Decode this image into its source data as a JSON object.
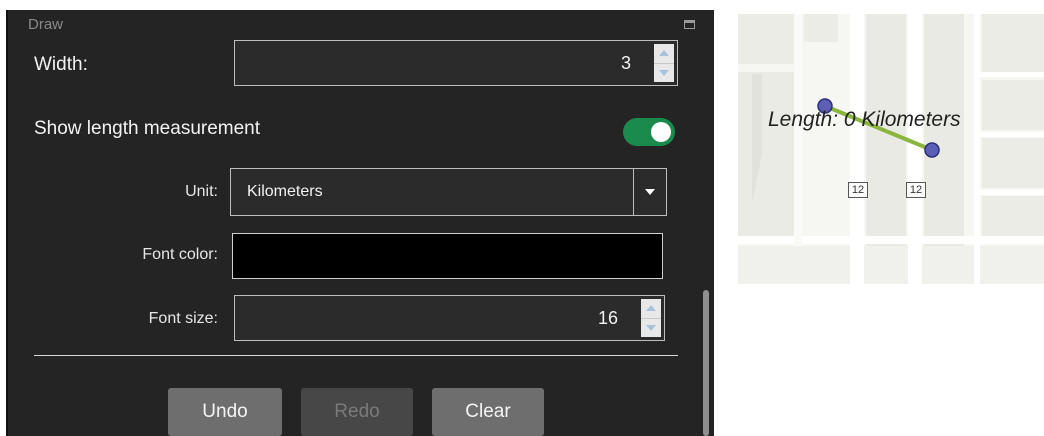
{
  "panel": {
    "title": "Draw",
    "width_label": "Width:",
    "width_value": "3",
    "show_length_label": "Show length measurement",
    "show_length_enabled": true,
    "unit_label": "Unit:",
    "unit_value": "Kilometers",
    "font_color_label": "Font color:",
    "font_color_value": "#000000",
    "font_size_label": "Font size:",
    "font_size_value": "16",
    "buttons": {
      "undo": "Undo",
      "redo": "Redo",
      "clear": "Clear"
    }
  },
  "map": {
    "measurement_label": "Length: 0 Kilometers",
    "route_shields": [
      "12",
      "12"
    ],
    "line_color": "#8ab53f",
    "vertex_color": "#5b5fb5"
  },
  "colors": {
    "panel_bg": "#242424",
    "toggle_on": "#1a8a4d"
  }
}
